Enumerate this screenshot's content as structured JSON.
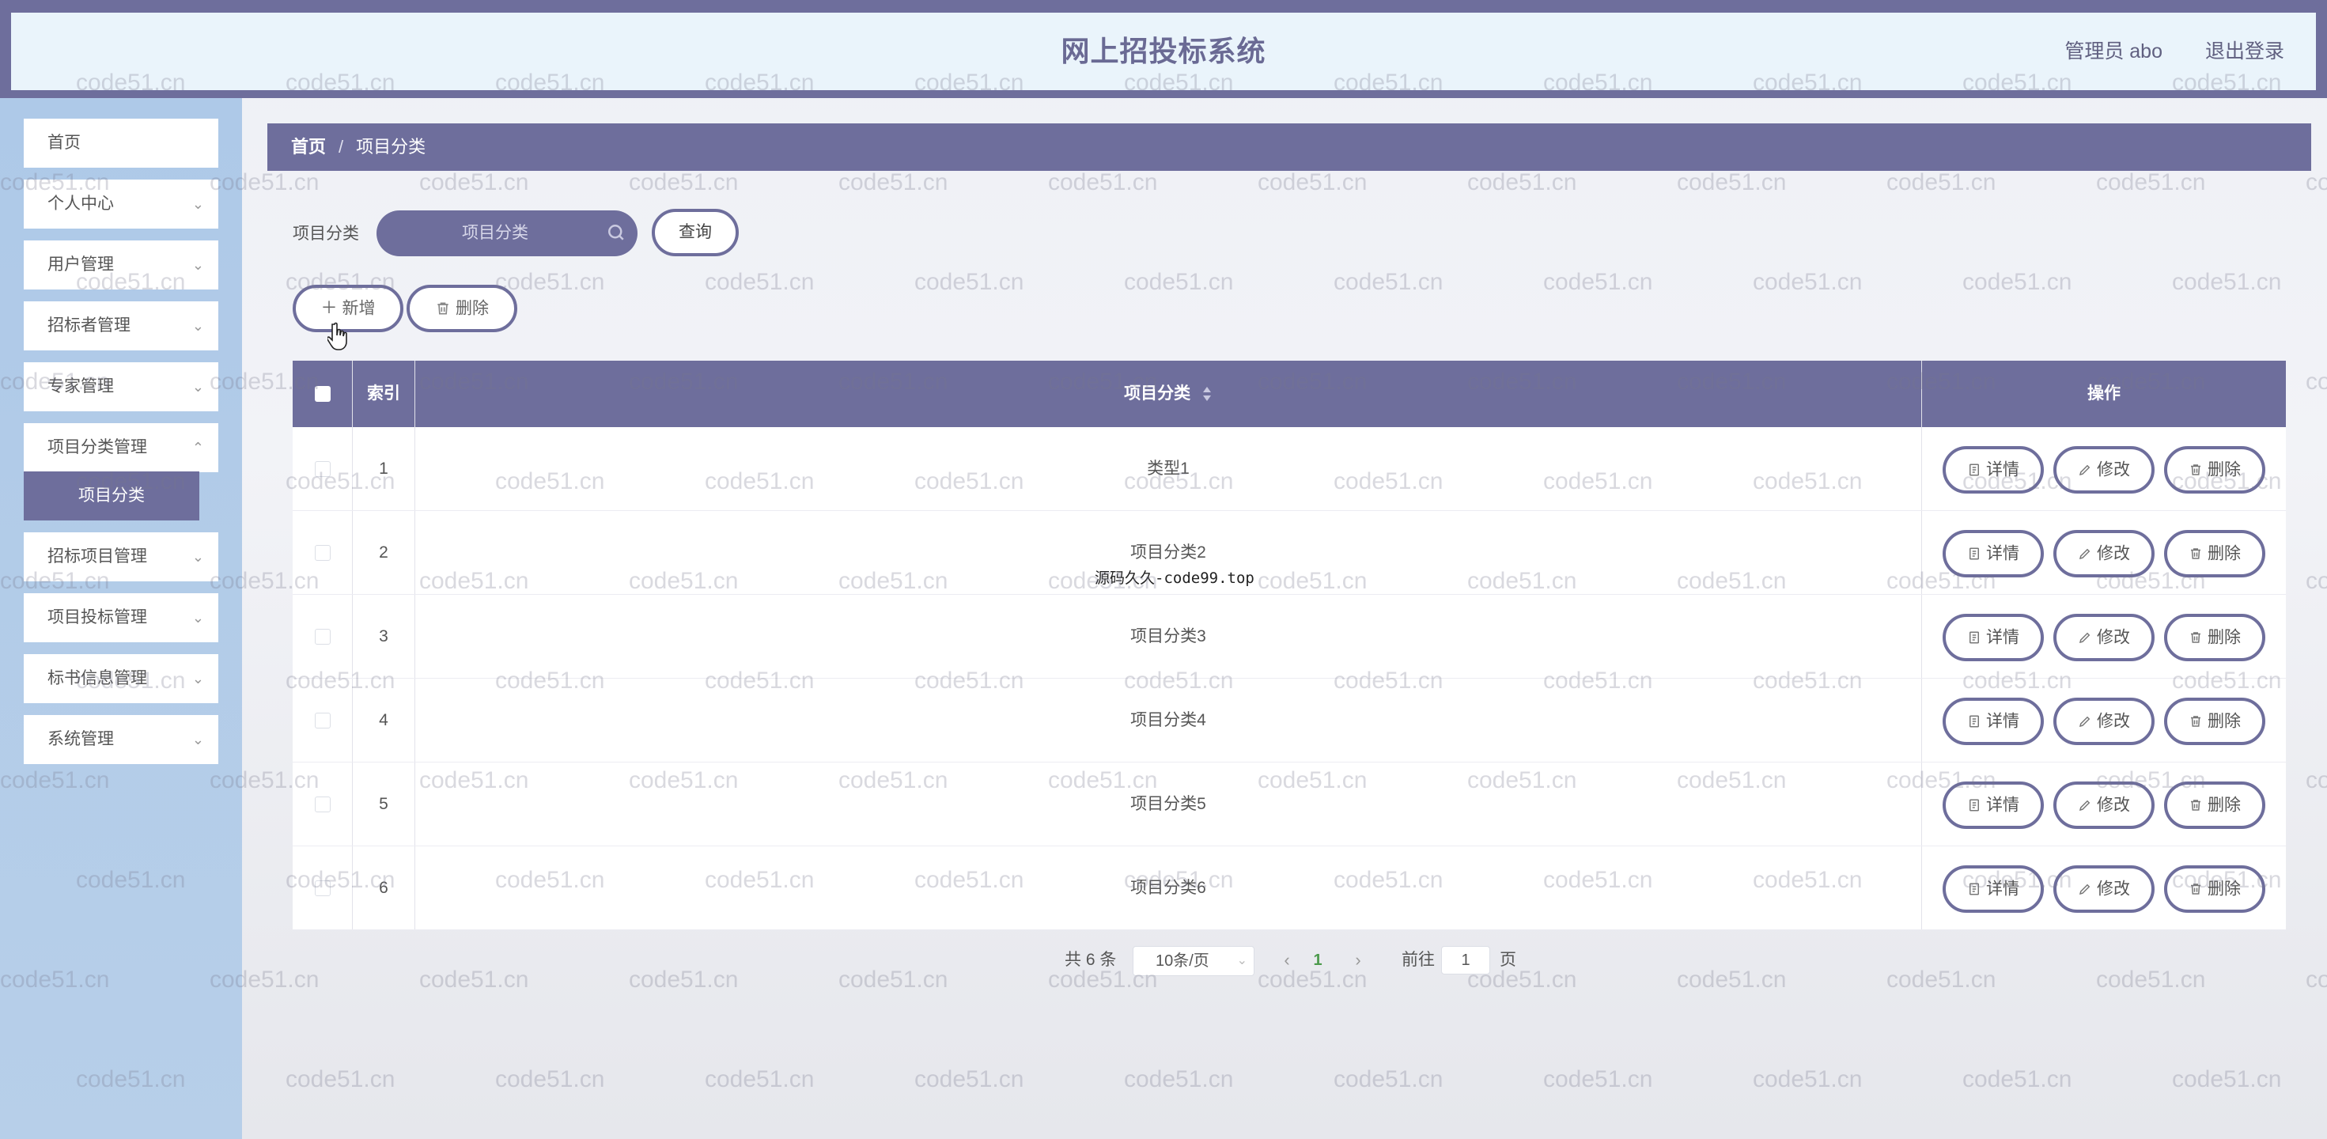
{
  "header": {
    "title": "网上招投标系统",
    "user": "管理员 abo",
    "logout": "退出登录"
  },
  "sidebar": {
    "items": [
      {
        "label": "首页"
      },
      {
        "label": "个人中心"
      },
      {
        "label": "用户管理"
      },
      {
        "label": "招标者管理"
      },
      {
        "label": "专家管理"
      },
      {
        "label": "项目分类管理"
      },
      {
        "label": "招标项目管理"
      },
      {
        "label": "项目投标管理"
      },
      {
        "label": "标书信息管理"
      },
      {
        "label": "系统管理"
      }
    ],
    "active_sub": "项目分类"
  },
  "breadcrumb": {
    "home": "首页",
    "separator": "/",
    "current": "项目分类"
  },
  "search": {
    "label": "项目分类",
    "placeholder": "项目分类",
    "button": "查询"
  },
  "actions": {
    "add": "新增",
    "delete": "删除"
  },
  "table": {
    "columns": [
      "索引",
      "项目分类",
      "操作"
    ],
    "rows": [
      {
        "index": "1",
        "category": "类型1"
      },
      {
        "index": "2",
        "category": "项目分类2"
      },
      {
        "index": "3",
        "category": "项目分类3"
      },
      {
        "index": "4",
        "category": "项目分类4"
      },
      {
        "index": "5",
        "category": "项目分类5"
      },
      {
        "index": "6",
        "category": "项目分类6"
      }
    ],
    "row_actions": {
      "detail": "详情",
      "edit": "修改",
      "delete": "删除"
    }
  },
  "pagination": {
    "total": "共 6 条",
    "page_size": "10条/页",
    "current_page": "1",
    "goto_label": "前往",
    "goto_value": "1",
    "goto_unit": "页"
  },
  "overlay": "源码久久-code99.top",
  "watermark": "code51.cn",
  "colors": {
    "primary": "#6e6e9c",
    "sidebar": "#aec9e8",
    "header_inner": "#eaf4fb"
  }
}
